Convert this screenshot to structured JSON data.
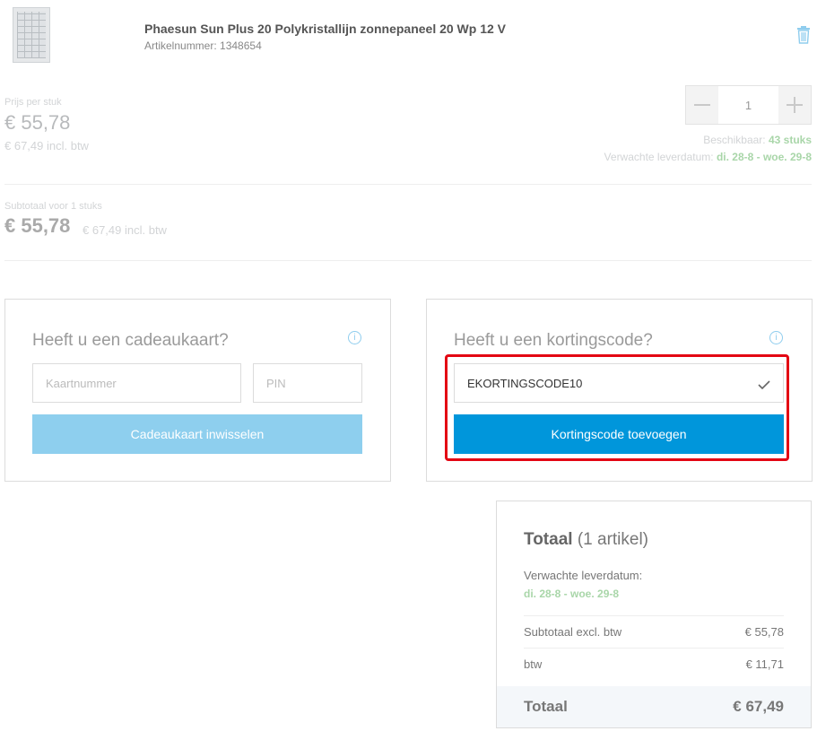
{
  "product": {
    "title": "Phaesun Sun Plus 20 Polykristallijn zonnepaneel 20 Wp 12 V",
    "sku_label": "Artikelnummer:",
    "sku": "1348654",
    "icons": {
      "thumbnail": "solar-panel-image",
      "remove": "trash-icon"
    }
  },
  "price": {
    "label": "Prijs per stuk",
    "excl": "€ 55,78",
    "incl": "€ 67,49 incl. btw"
  },
  "quantity": {
    "value": "1",
    "icons": {
      "decrease": "minus-icon",
      "increase": "plus-icon"
    }
  },
  "stock": {
    "label": "Beschikbaar:",
    "value": "43 stuks"
  },
  "delivery": {
    "label": "Verwachte leverdatum:",
    "value": "di. 28-8 - woe. 29-8"
  },
  "subtotal_line": {
    "label": "Subtotaal voor 1 stuks",
    "excl": "€ 55,78",
    "incl": "€ 67,49 incl. btw"
  },
  "gift_card": {
    "title": "Heeft u een cadeaukaart?",
    "card_placeholder": "Kaartnummer",
    "pin_placeholder": "PIN",
    "button": "Cadeaukaart inwisselen",
    "button_color": "#8ecfee"
  },
  "discount": {
    "title": "Heeft u een kortingscode?",
    "value": "EKORTINGSCODE10",
    "button": "Kortingscode toevoegen",
    "button_color": "#0096db",
    "highlight_color": "#e30613"
  },
  "total": {
    "title_bold": "Totaal",
    "title_rest": "(1 artikel)",
    "delivery_label": "Verwachte leverdatum:",
    "delivery_value": "di. 28-8 - woe. 29-8",
    "rows": [
      {
        "label": "Subtotaal excl. btw",
        "value": "€ 55,78"
      },
      {
        "label": "btw",
        "value": "€ 11,71"
      }
    ],
    "grand_label": "Totaal",
    "grand_value": "€ 67,49"
  }
}
